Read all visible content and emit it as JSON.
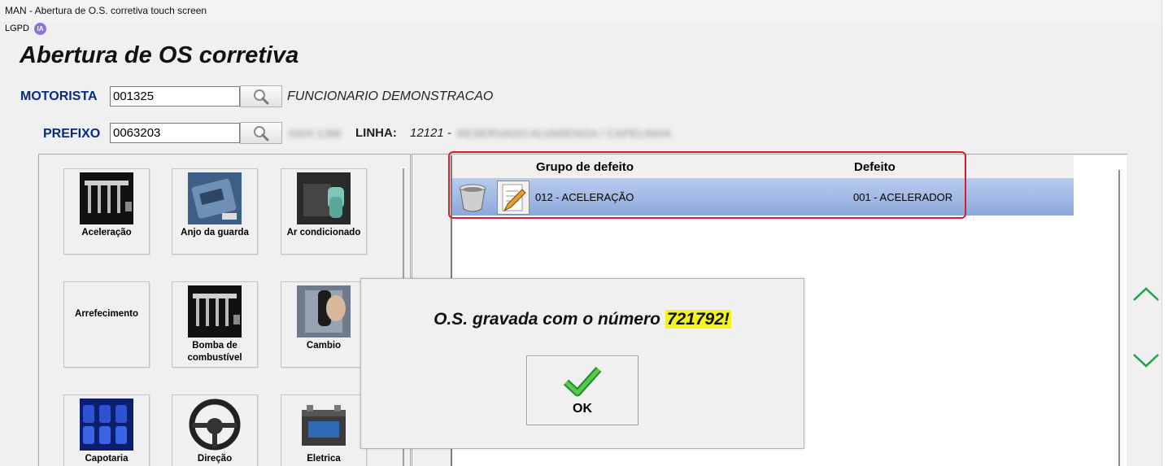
{
  "window": {
    "title": "MAN - Abertura de O.S. corretiva touch screen"
  },
  "menubar": {
    "lgpd": "LGPD",
    "ia": "IA"
  },
  "page": {
    "title": "Abertura de OS corretiva"
  },
  "motorista": {
    "label": "MOTORISTA",
    "value": "001325",
    "name": "FUNCIONARIO DEMONSTRACAO"
  },
  "prefixo": {
    "label": "PREFIXO",
    "value": "0063203",
    "vehicle_blurred": "GKH 1J66",
    "linha_label": "LINHA:",
    "linha_code": "12121 -",
    "linha_name_blurred": "RESERVADO ALVARENGA / CAPELINHA"
  },
  "groups": [
    {
      "label": "Aceleração",
      "icon": "injector-rail-image"
    },
    {
      "label": "Anjo da guarda",
      "icon": "control-module-image"
    },
    {
      "label": "Ar condicionado",
      "icon": "ac-controls-image"
    },
    {
      "label": "Arrefecimento",
      "icon": ""
    },
    {
      "label": "Bomba de combustível",
      "icon": "injector-rail-image"
    },
    {
      "label": "Cambio",
      "icon": "gear-shift-image"
    },
    {
      "label": "Capotaria",
      "icon": "bus-seats-image"
    },
    {
      "label": "Direção",
      "icon": "steering-wheel-image"
    },
    {
      "label": "Eletrica",
      "icon": "battery-image"
    }
  ],
  "defects_table": {
    "headers": {
      "group": "Grupo de defeito",
      "defect": "Defeito"
    },
    "rows": [
      {
        "group": "012 - ACELERAÇÃO",
        "defect": "001 - ACELERADOR"
      }
    ]
  },
  "dialog": {
    "message_prefix": "O.S. gravada com o número ",
    "os_number": "721792!",
    "ok_label": "OK"
  },
  "colors": {
    "label_blue": "#0a2a80",
    "highlight_red": "#d81e2a",
    "row_blue": "#9fb7e2",
    "number_highlight": "#f3f31e",
    "arrow_green": "#1fa24a"
  }
}
